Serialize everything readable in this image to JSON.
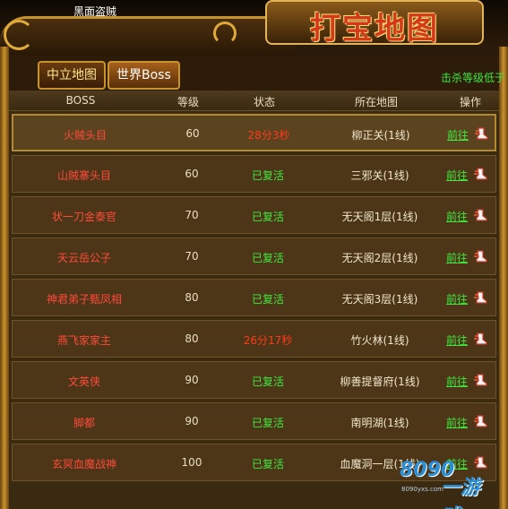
{
  "top_name": "黑面盗贼",
  "title": "打宝地图",
  "tabs": [
    {
      "label": "中立地图",
      "active": false
    },
    {
      "label": "世界Boss",
      "active": true
    }
  ],
  "kill_note": "击杀等级低于",
  "columns": {
    "boss": "BOSS",
    "level": "等级",
    "status": "状态",
    "map": "所在地图",
    "action": "操作"
  },
  "rows": [
    {
      "boss": "火贼头目",
      "level": "60",
      "status": "28分3秒",
      "status_type": "dead",
      "map": "柳正关(1线)",
      "action": "前往"
    },
    {
      "boss": "山贼寨头目",
      "level": "60",
      "status": "已复活",
      "status_type": "alive",
      "map": "三邪关(1线)",
      "action": "前往"
    },
    {
      "boss": "状一刀金泰官",
      "level": "70",
      "status": "已复活",
      "status_type": "alive",
      "map": "无天阁1层(1线)",
      "action": "前往"
    },
    {
      "boss": "天云岳公子",
      "level": "70",
      "status": "已复活",
      "status_type": "alive",
      "map": "无天阁2层(1线)",
      "action": "前往"
    },
    {
      "boss": "神君弟子甄凤相",
      "level": "80",
      "status": "已复活",
      "status_type": "alive",
      "map": "无天阁3层(1线)",
      "action": "前往"
    },
    {
      "boss": "燕飞家家主",
      "level": "80",
      "status": "26分17秒",
      "status_type": "dead",
      "map": "竹火林(1线)",
      "action": "前往"
    },
    {
      "boss": "文英侠",
      "level": "90",
      "status": "已复活",
      "status_type": "alive",
      "map": "柳善提督府(1线)",
      "action": "前往"
    },
    {
      "boss": "脚都",
      "level": "90",
      "status": "已复活",
      "status_type": "alive",
      "map": "南明湖(1线)",
      "action": "前往"
    },
    {
      "boss": "玄冥血魔战神",
      "level": "100",
      "status": "已复活",
      "status_type": "alive",
      "map": "血魔洞一层(1线)",
      "action": "前往"
    }
  ],
  "watermark": {
    "brand": "8090",
    "game": "一游戏",
    "url": "8090yxs.com"
  },
  "colors": {
    "alive": "#3ee83e",
    "dead": "#ff3a1a",
    "boss_name": "#ff4a3a",
    "frame_gold": "#c9932b"
  }
}
